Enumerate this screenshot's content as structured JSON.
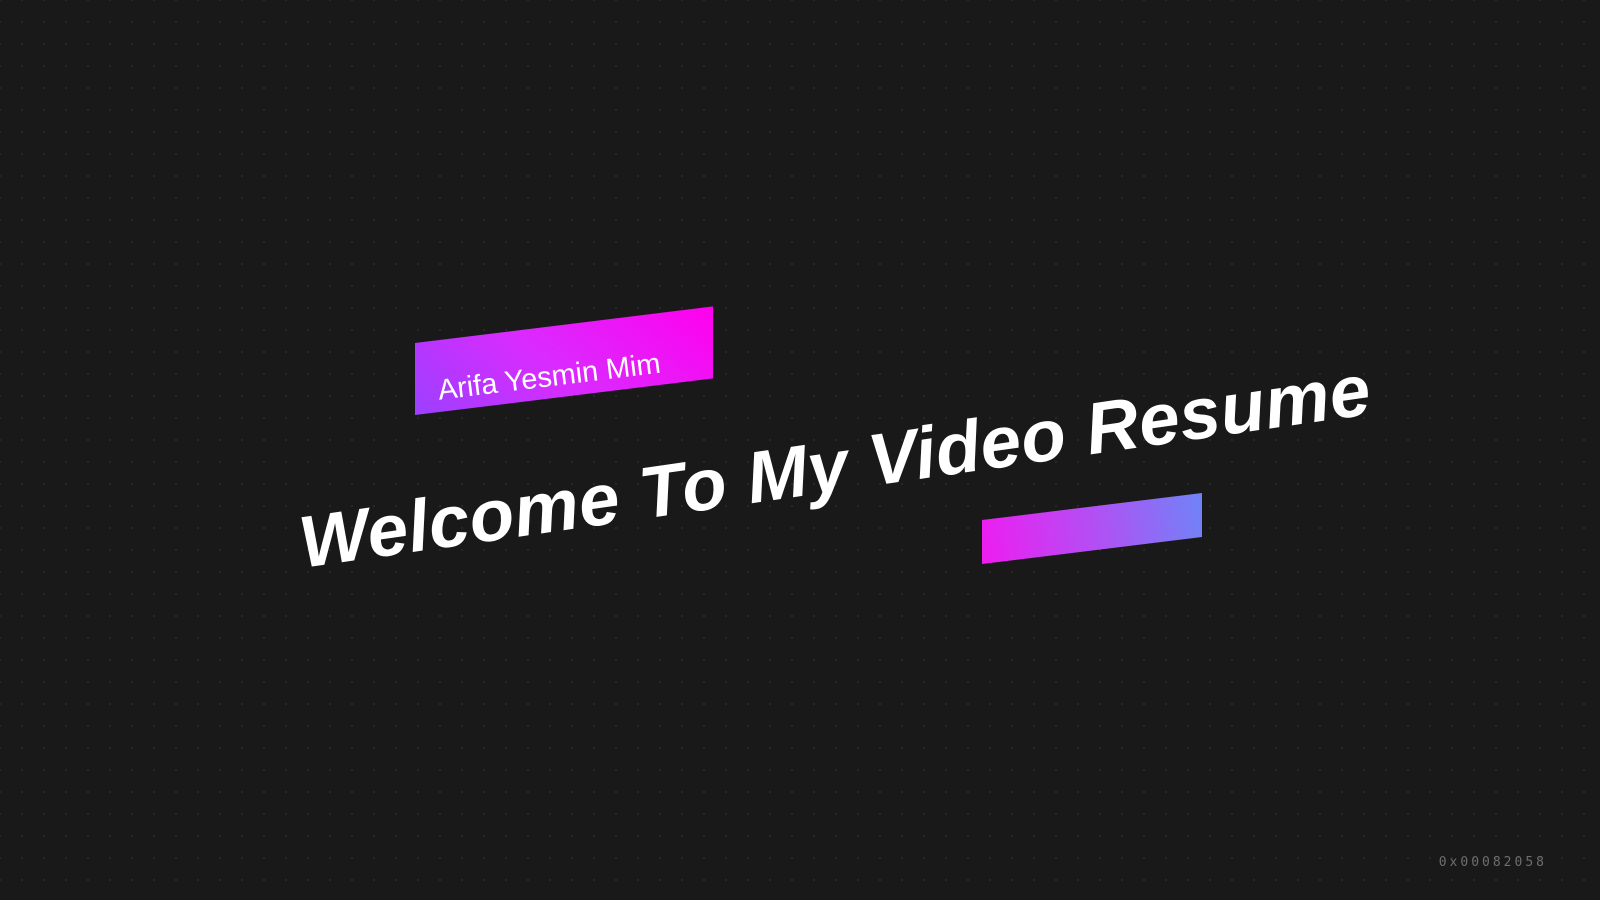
{
  "title_card": {
    "name": "Arifa Yesmin Mim",
    "headline": "Welcome To My Video Resume",
    "frame_code": "0x00082058"
  },
  "colors": {
    "background": "#191919",
    "name_tag_start": "#9b40ff",
    "name_tag_end": "#ff00ee",
    "accent_bar_start": "#ef1cf0",
    "accent_bar_end": "#6f84f6",
    "text": "#ffffff"
  }
}
